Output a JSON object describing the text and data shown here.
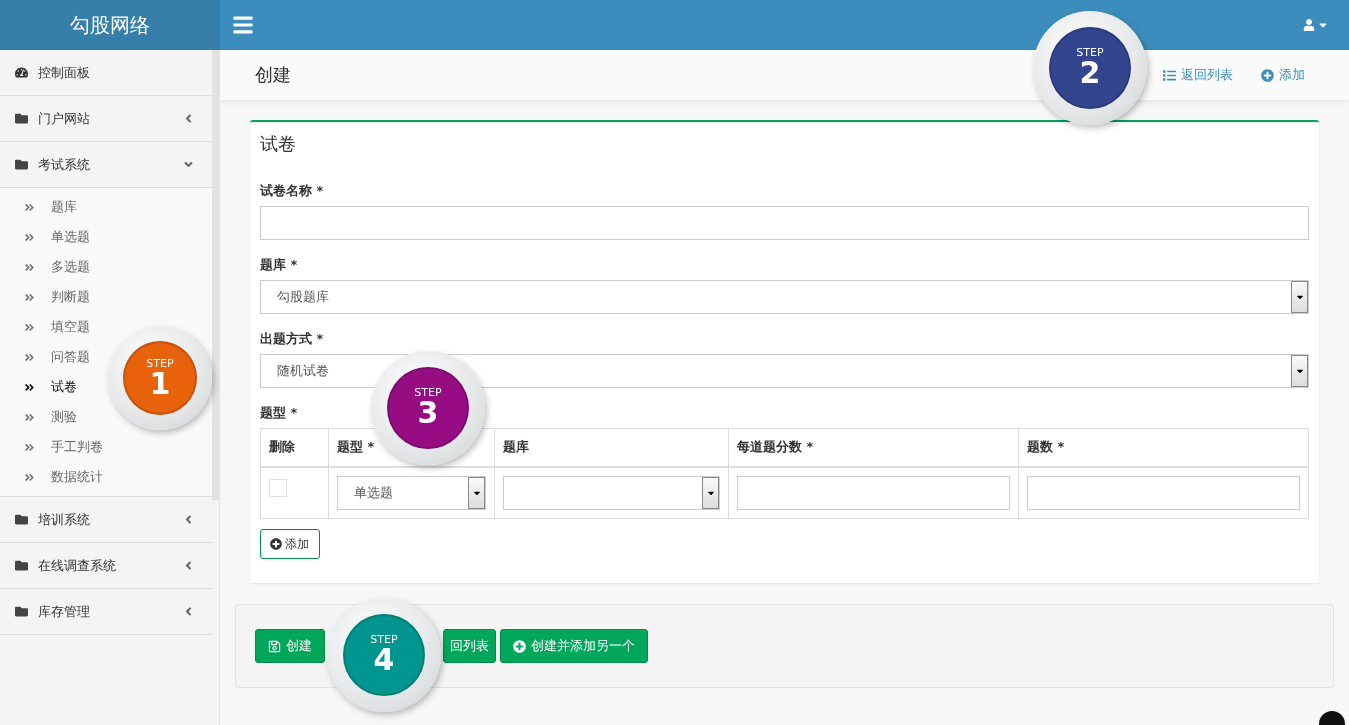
{
  "brand": "勾股网络",
  "page_title": "创建",
  "header_actions": [
    {
      "label": "返回列表",
      "kind": "list"
    },
    {
      "label": "添加",
      "kind": "add"
    }
  ],
  "sidebar": {
    "items": [
      {
        "label": "控制面板",
        "kind": "dashboard"
      },
      {
        "label": "门户网站",
        "kind": "folder",
        "expanded": false
      },
      {
        "label": "考试系统",
        "kind": "folder",
        "expanded": true,
        "children": [
          {
            "label": "题库",
            "selected": false
          },
          {
            "label": "单选题",
            "selected": false
          },
          {
            "label": "多选题",
            "selected": false
          },
          {
            "label": "判断题",
            "selected": false
          },
          {
            "label": "填空题",
            "selected": false
          },
          {
            "label": "问答题",
            "selected": false
          },
          {
            "label": "试卷",
            "selected": true
          },
          {
            "label": "测验",
            "selected": false
          },
          {
            "label": "手工判卷",
            "selected": false
          },
          {
            "label": "数据统计",
            "selected": false
          }
        ]
      },
      {
        "label": "培训系统",
        "kind": "folder",
        "expanded": false
      },
      {
        "label": "在线调查系统",
        "kind": "folder",
        "expanded": false
      },
      {
        "label": "库存管理",
        "kind": "folder",
        "expanded": false
      }
    ]
  },
  "form": {
    "title": "试卷",
    "fields": [
      {
        "label": "试卷名称 *",
        "kind": "text"
      },
      {
        "label": "题库 *",
        "kind": "select",
        "value": "勾股题库"
      },
      {
        "label": "出题方式 *",
        "kind": "select",
        "value": "随机试卷"
      }
    ],
    "table": {
      "label": "题型 *",
      "columns": [
        "删除",
        "题型 *",
        "题库",
        "每道题分数 *",
        "题数 *"
      ],
      "rows": [
        {
          "cells": [
            {
              "kind": "checkbox",
              "checked": false
            },
            {
              "kind": "select",
              "value": "单选题"
            },
            {
              "kind": "select"
            },
            {
              "kind": "text"
            },
            {
              "kind": "text"
            }
          ]
        }
      ]
    },
    "add_button": "添加"
  },
  "footer_buttons": [
    {
      "label": "创建",
      "kind": "save"
    },
    {
      "label": "回列表",
      "kind": "plain"
    },
    {
      "label": "创建并添加另一个",
      "kind": "add"
    }
  ],
  "steps": [
    {
      "label": "STEP",
      "number": "1",
      "color": "#e8620c"
    },
    {
      "label": "STEP",
      "number": "2",
      "color": "#34458f"
    },
    {
      "label": "STEP",
      "number": "3",
      "color": "#960c83"
    },
    {
      "label": "STEP",
      "number": "4",
      "color": "#00968f"
    }
  ]
}
